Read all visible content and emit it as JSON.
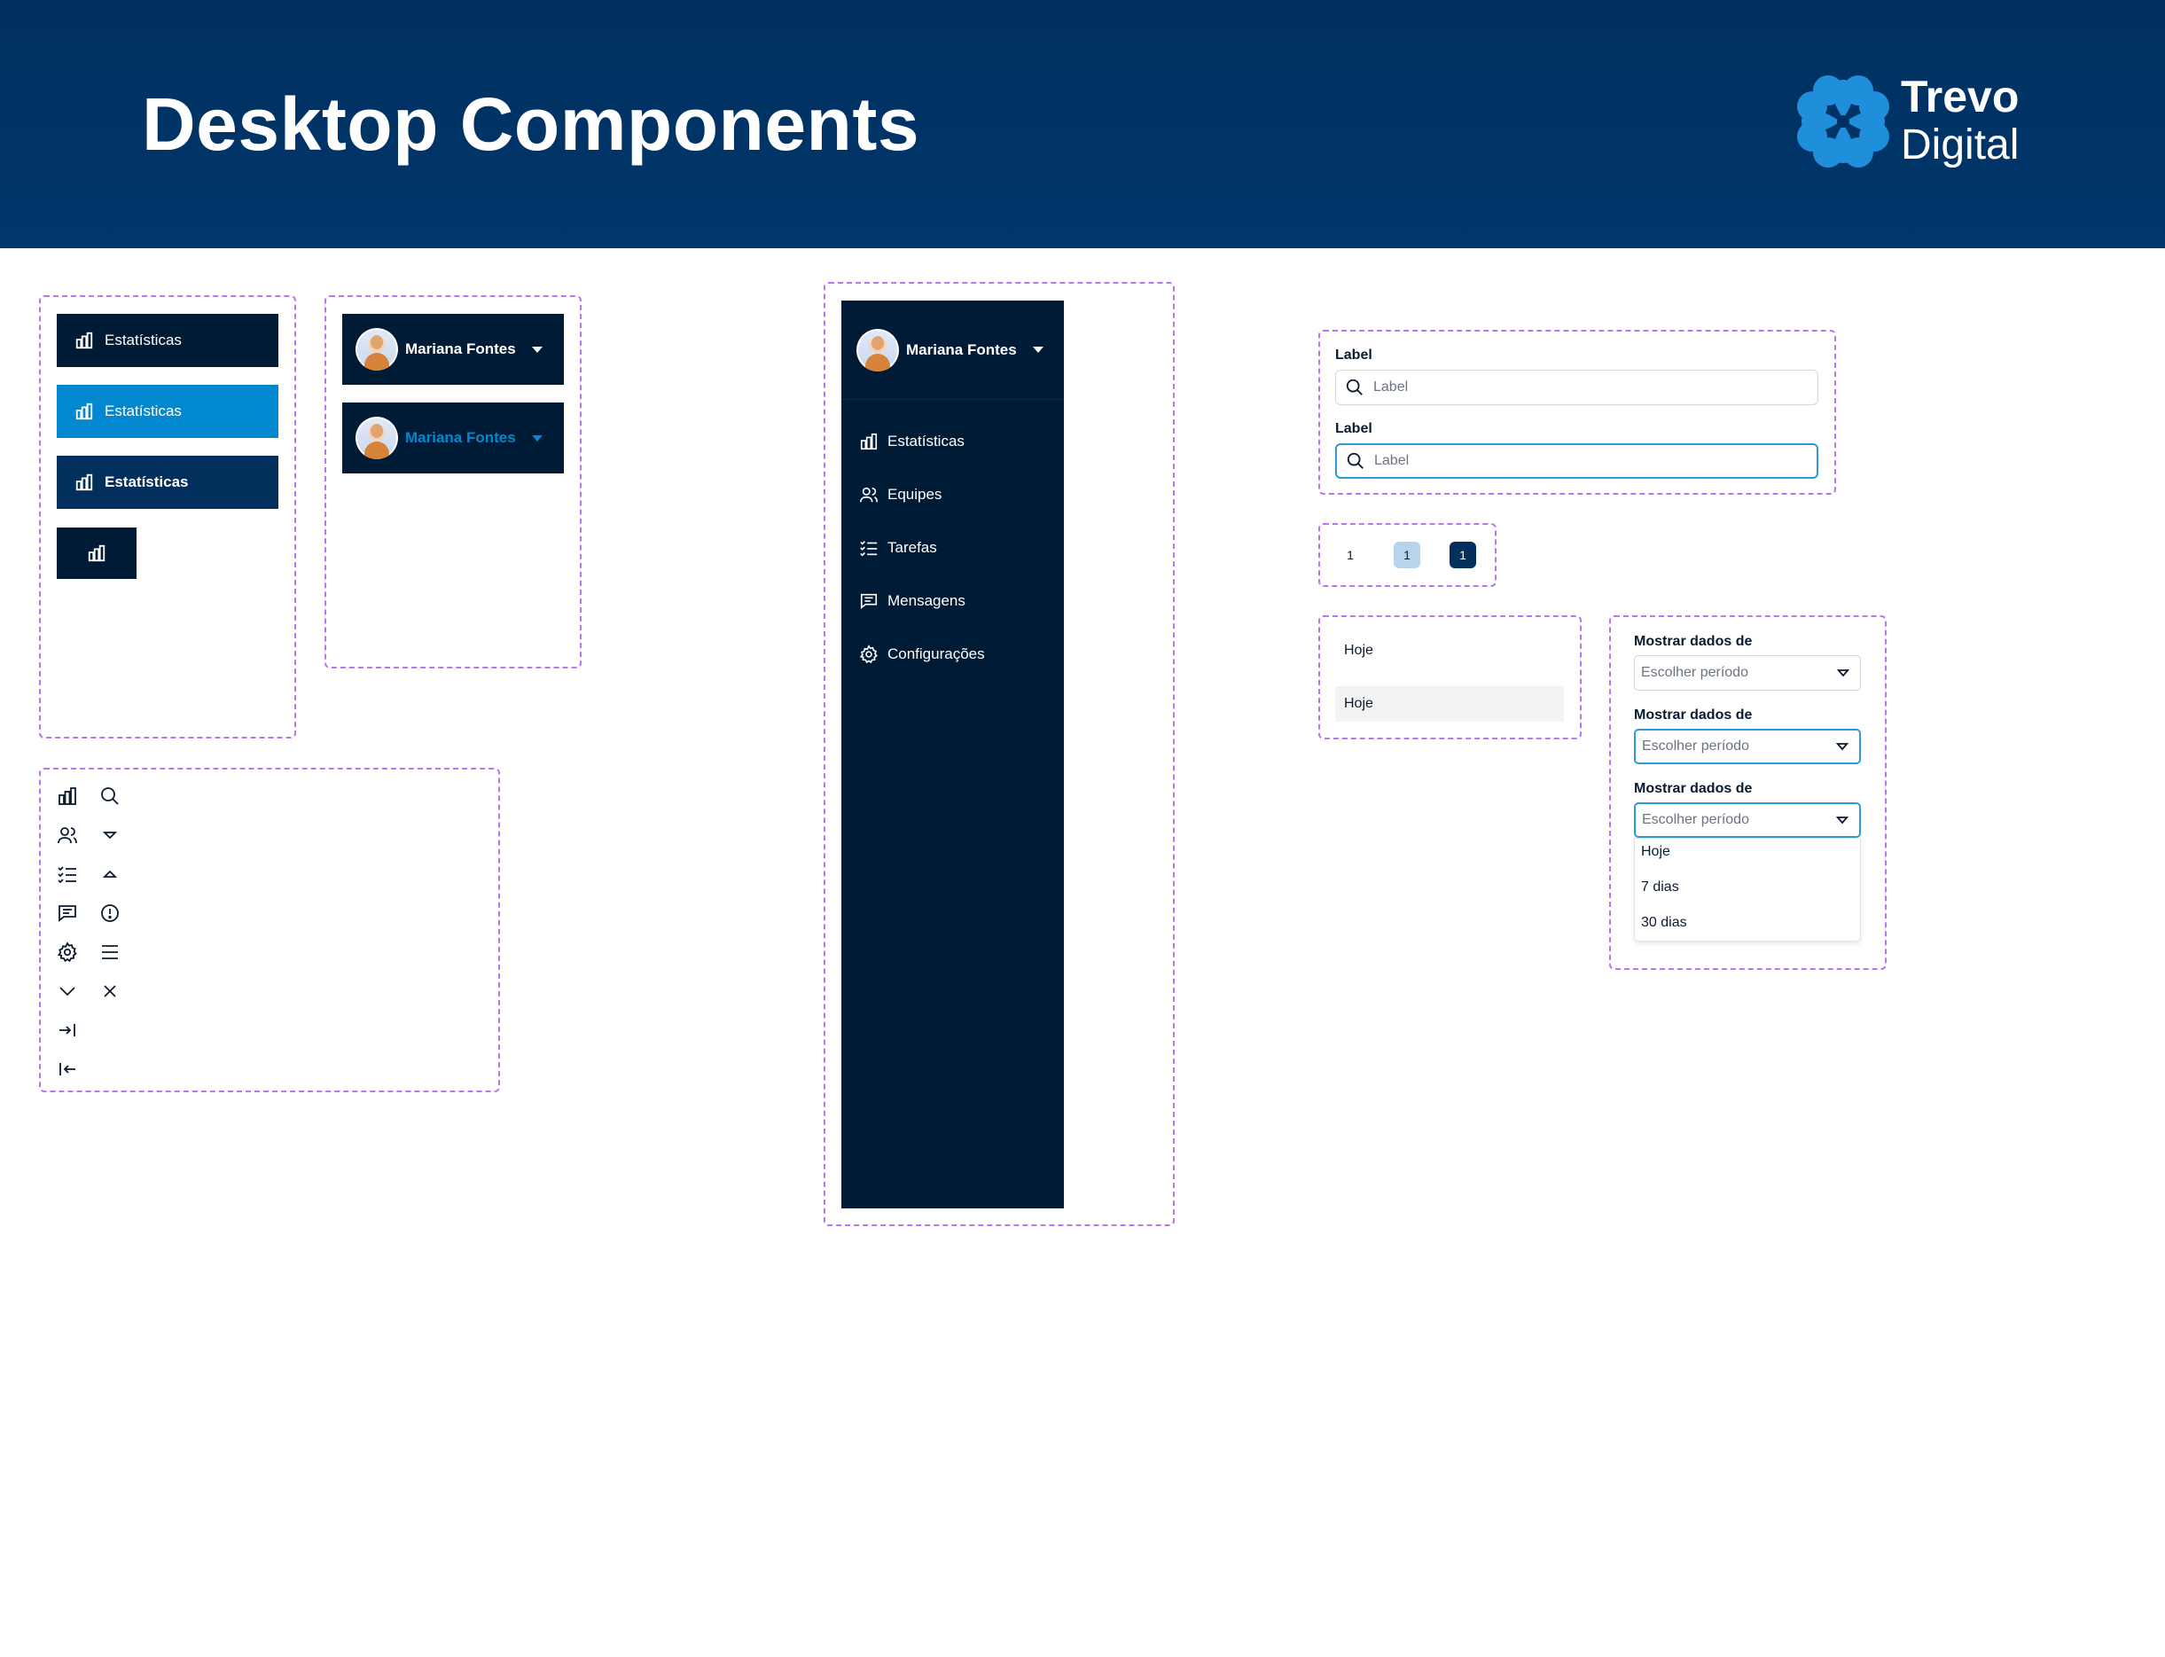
{
  "header": {
    "title": "Desktop Components",
    "brand_line1": "Trevo",
    "brand_line2": "Digital",
    "logo_icon": "clover-logo-icon"
  },
  "nav_buttons": {
    "default_label": "Estatísticas",
    "hover_label": "Estatísticas",
    "active_label": "Estatísticas",
    "icon": "bar-chart-icon"
  },
  "user_menu": {
    "name": "Mariana Fontes",
    "name_hover": "Mariana Fontes",
    "icon": "caret-down-icon"
  },
  "sidebar": {
    "user_name": "Mariana Fontes",
    "items": [
      {
        "label": "Estatísticas",
        "icon": "bar-chart-icon"
      },
      {
        "label": "Equipes",
        "icon": "users-icon"
      },
      {
        "label": "Tarefas",
        "icon": "checklist-icon"
      },
      {
        "label": "Mensagens",
        "icon": "message-icon"
      },
      {
        "label": "Configurações",
        "icon": "gear-icon"
      }
    ]
  },
  "icons": [
    "bar-chart-icon",
    "search-icon",
    "users-icon",
    "caret-down-icon",
    "checklist-icon",
    "caret-up-icon",
    "message-icon",
    "alert-circle-icon",
    "gear-icon",
    "menu-icon",
    "chevron-down-icon",
    "close-icon",
    "expand-sidebar-icon",
    "collapse-sidebar-icon"
  ],
  "search_inputs": [
    {
      "label": "Label",
      "placeholder": "Label"
    },
    {
      "label": "Label",
      "placeholder": "Label"
    }
  ],
  "pagination": [
    "1",
    "1",
    "1"
  ],
  "list_options": [
    "Hoje",
    "Hoje"
  ],
  "selects": {
    "label": "Mostrar dados de",
    "placeholder": "Escolher período",
    "options": [
      "Hoje",
      "7 dias",
      "30 dias"
    ]
  },
  "colors": {
    "header_bg": "#00305f",
    "sidebar_bg": "#001b36",
    "accent": "#0288d0",
    "active_nav": "#022f5c",
    "focus_border": "#2a9bd6",
    "frame_dash": "#b775f0"
  }
}
